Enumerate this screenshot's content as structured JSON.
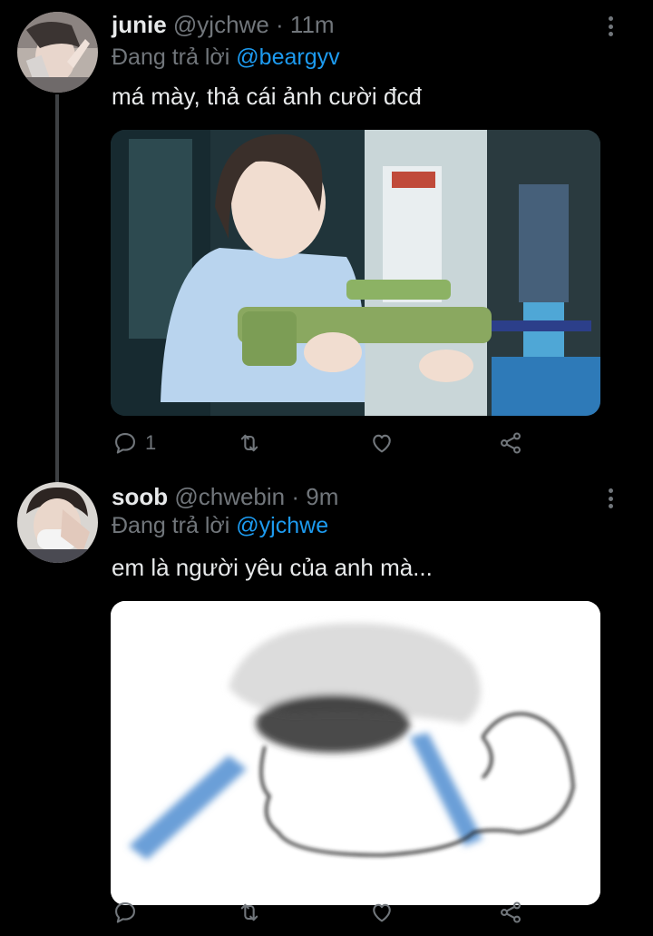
{
  "thread": [
    {
      "author": {
        "name": "junie",
        "handle": "@yjchwe",
        "time": "11m"
      },
      "reply_prefix": "Đang trả lời",
      "reply_to": "@beargyv",
      "text": "má mày, thả cái ảnh cười đcđ",
      "media": "photo of a person holding a green toy water gun",
      "reply_count": "1"
    },
    {
      "author": {
        "name": "soob",
        "handle": "@chwebin",
        "time": "9m"
      },
      "reply_prefix": "Đang trả lời",
      "reply_to": "@yjchwe",
      "text": "em là người yêu của anh mà...",
      "media": "blurry crying cartoon face sketch",
      "reply_count": ""
    }
  ],
  "separator": "·",
  "colors": {
    "background": "#000000",
    "muted": "#71767b",
    "accent": "#1d9bf0",
    "text": "#e7e9ea"
  },
  "icons": [
    "reply-icon",
    "retweet-icon",
    "like-icon",
    "share-icon",
    "more-icon"
  ]
}
